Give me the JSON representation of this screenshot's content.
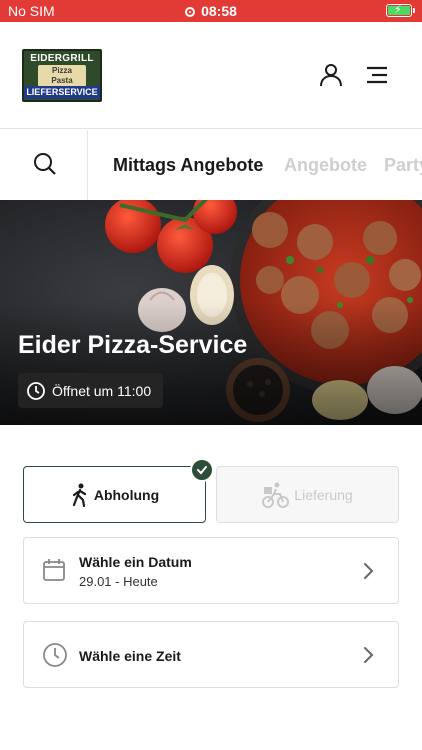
{
  "status_bar": {
    "carrier": "No SIM",
    "time": "08:58",
    "battery_color": "#4cd964",
    "bar_color": "#e23b36"
  },
  "header": {
    "logo": {
      "top_text": "EIDERGRILL",
      "line1": "Pizza",
      "line2": "Pasta",
      "line3": "& mehr",
      "bottom_text": "LIEFERSERVICE"
    },
    "icons": [
      "user-icon",
      "menu-icon"
    ]
  },
  "categories": {
    "items": [
      {
        "label": "Mittags Angebote",
        "active": true
      },
      {
        "label": "Angebote",
        "active": false
      },
      {
        "label": "Party",
        "active": false
      }
    ]
  },
  "hero": {
    "title": "Eider Pizza-Service",
    "hours": "Öffnet um 11:00"
  },
  "order_mode": {
    "pickup_label": "Abholung",
    "delivery_label": "Lieferung",
    "selected": "pickup",
    "accent_color": "#2e4d39"
  },
  "date_row": {
    "label": "Wähle ein Datum",
    "value": "29.01 - Heute"
  },
  "time_row": {
    "label": "Wähle eine Zeit"
  }
}
